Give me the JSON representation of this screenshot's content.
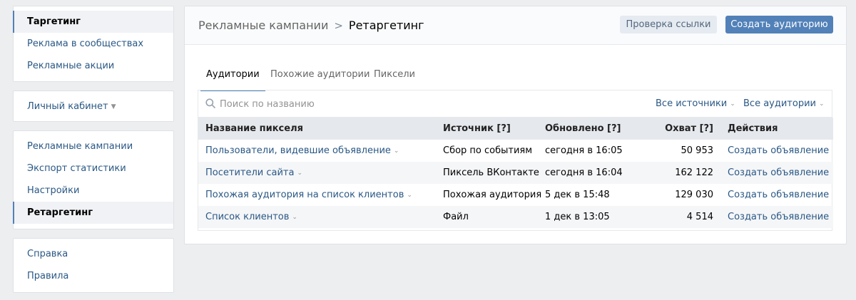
{
  "sidebar": {
    "group1": [
      {
        "label": "Таргетинг",
        "active": true
      },
      {
        "label": "Реклама в сообществах"
      },
      {
        "label": "Рекламные акции"
      }
    ],
    "account": {
      "label": "Личный кабинет"
    },
    "group3": [
      {
        "label": "Рекламные кампании"
      },
      {
        "label": "Экспорт статистики"
      },
      {
        "label": "Настройки"
      },
      {
        "label": "Ретаргетинг",
        "active": true
      }
    ],
    "group4": [
      {
        "label": "Справка"
      },
      {
        "label": "Правила"
      }
    ]
  },
  "header": {
    "breadcrumb_parent": "Рекламные кампании",
    "breadcrumb_separator": ">",
    "breadcrumb_current": "Ретаргетинг",
    "check_link_button": "Проверка ссылки",
    "create_audience_button": "Создать аудиторию"
  },
  "tabs": [
    {
      "label": "Аудитории",
      "active": true
    },
    {
      "label": "Похожие аудитории"
    },
    {
      "label": "Пиксели"
    }
  ],
  "filters": {
    "search_placeholder": "Поиск по названию",
    "search_value": "",
    "sources_label": "Все источники",
    "audiences_label": "Все аудитории"
  },
  "table": {
    "headers": {
      "name": "Название пикселя",
      "source": "Источник [?]",
      "updated": "Обновлено [?]",
      "reach": "Охват [?]",
      "actions": "Действия"
    },
    "rows": [
      {
        "name": "Пользователи, видевшие объявление",
        "source": "Сбор по событиям",
        "updated": "сегодня в 16:05",
        "reach": "50 953",
        "action": "Создать объявление"
      },
      {
        "name": "Посетители сайта",
        "source": "Пиксель ВКонтакте",
        "updated": "сегодня в 16:04",
        "reach": "162 122",
        "action": "Создать объявление"
      },
      {
        "name": "Похожая аудитория на список клиентов",
        "source": "Похожая аудитория",
        "updated": "5 дек в 15:48",
        "reach": "129 030",
        "action": "Создать объявление"
      },
      {
        "name": "Список клиентов",
        "source": "Файл",
        "updated": "1 дек в 13:05",
        "reach": "4 514",
        "action": "Создать объявление"
      }
    ]
  },
  "icons": {
    "chevron": "chevron-down-icon",
    "search": "search-icon"
  },
  "colors": {
    "accent": "#5181b8",
    "link": "#2a5885",
    "background": "#edeef0"
  }
}
